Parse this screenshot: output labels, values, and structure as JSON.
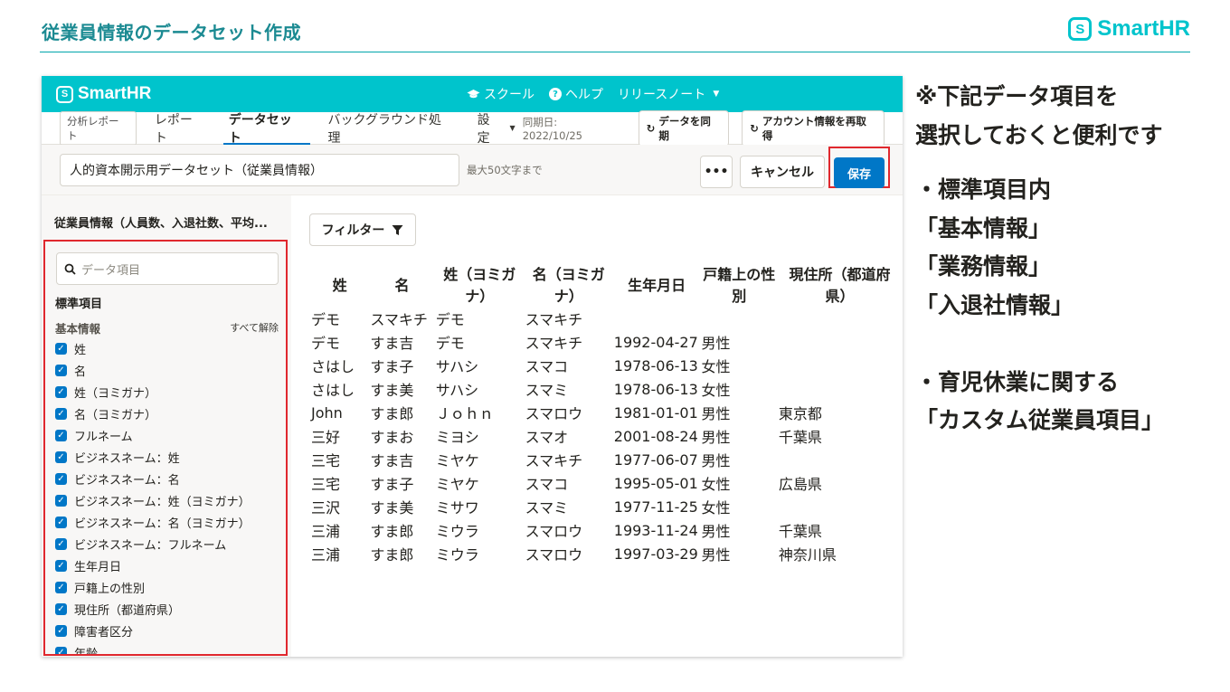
{
  "slide": {
    "title": "従業員情報のデータセット作成",
    "brand": "SmartHR",
    "brand_mark": "S"
  },
  "app": {
    "logo": "SmartHR",
    "top_links": [
      "スクール",
      "ヘルプ",
      "リリースノート"
    ],
    "tabs_chip": "分析レポート",
    "tabs": [
      "レポート",
      "データセット",
      "バックグラウンド処理",
      "設定"
    ],
    "sync_date": "同期日: 2022/10/25",
    "sync_button": "データを同期",
    "reacquire_button": "アカウント情報を再取得",
    "dataset_name": "人的資本開示用データセット（従業員情報）",
    "name_hint": "最大50文字まで",
    "more_label": "•••",
    "cancel_label": "キャンセル",
    "save_label": "保存"
  },
  "sidebar": {
    "title": "従業員情報（人員数、入退社数、平均...",
    "search_placeholder": "データ項目",
    "standard_heading": "標準項目",
    "basic_heading": "基本情報",
    "clear_all": "すべて解除",
    "items": [
      "姓",
      "名",
      "姓（ヨミガナ）",
      "名（ヨミガナ）",
      "フルネーム",
      "ビジネスネーム：姓",
      "ビジネスネーム：名",
      "ビジネスネーム：姓（ヨミガナ）",
      "ビジネスネーム：名（ヨミガナ）",
      "ビジネスネーム：フルネーム",
      "生年月日",
      "戸籍上の性別",
      "現住所（都道府県）",
      "障害者区分",
      "年齢"
    ]
  },
  "main": {
    "filter_label": "フィルター",
    "columns": [
      "姓",
      "名",
      "姓（ヨミガナ）",
      "名（ヨミガナ）",
      "生年月日",
      "戸籍上の性別",
      "現住所（都道府県）"
    ],
    "rows": [
      [
        "デモ",
        "スマキチ",
        "デモ",
        "スマキチ",
        "",
        "",
        ""
      ],
      [
        "デモ",
        "すま吉",
        "デモ",
        "スマキチ",
        "1992-04-27",
        "男性",
        ""
      ],
      [
        "さはし",
        "すま子",
        "サハシ",
        "スマコ",
        "1978-06-13",
        "女性",
        ""
      ],
      [
        "さはし",
        "すま美",
        "サハシ",
        "スマミ",
        "1978-06-13",
        "女性",
        ""
      ],
      [
        "John",
        "すま郎",
        "Ｊｏｈｎ",
        "スマロウ",
        "1981-01-01",
        "男性",
        "東京都"
      ],
      [
        "三好",
        "すまお",
        "ミヨシ",
        "スマオ",
        "2001-08-24",
        "男性",
        "千葉県"
      ],
      [
        "三宅",
        "すま吉",
        "ミヤケ",
        "スマキチ",
        "1977-06-07",
        "男性",
        ""
      ],
      [
        "三宅",
        "すま子",
        "ミヤケ",
        "スマコ",
        "1995-05-01",
        "女性",
        "広島県"
      ],
      [
        "三沢",
        "すま美",
        "ミサワ",
        "スマミ",
        "1977-11-25",
        "女性",
        ""
      ],
      [
        "三浦",
        "すま郎",
        "ミウラ",
        "スマロウ",
        "1993-11-24",
        "男性",
        "千葉県"
      ],
      [
        "三浦",
        "すま郎",
        "ミウラ",
        "スマロウ",
        "1997-03-29",
        "男性",
        "神奈川県"
      ]
    ]
  },
  "note": {
    "lines": [
      "※下記データ項目を",
      "選択しておくと便利です",
      "・標準項目内",
      "「基本情報」",
      "「業務情報」",
      "「入退社情報」",
      "",
      "・育児休業に関する",
      "「カスタム従業員項目」"
    ]
  }
}
